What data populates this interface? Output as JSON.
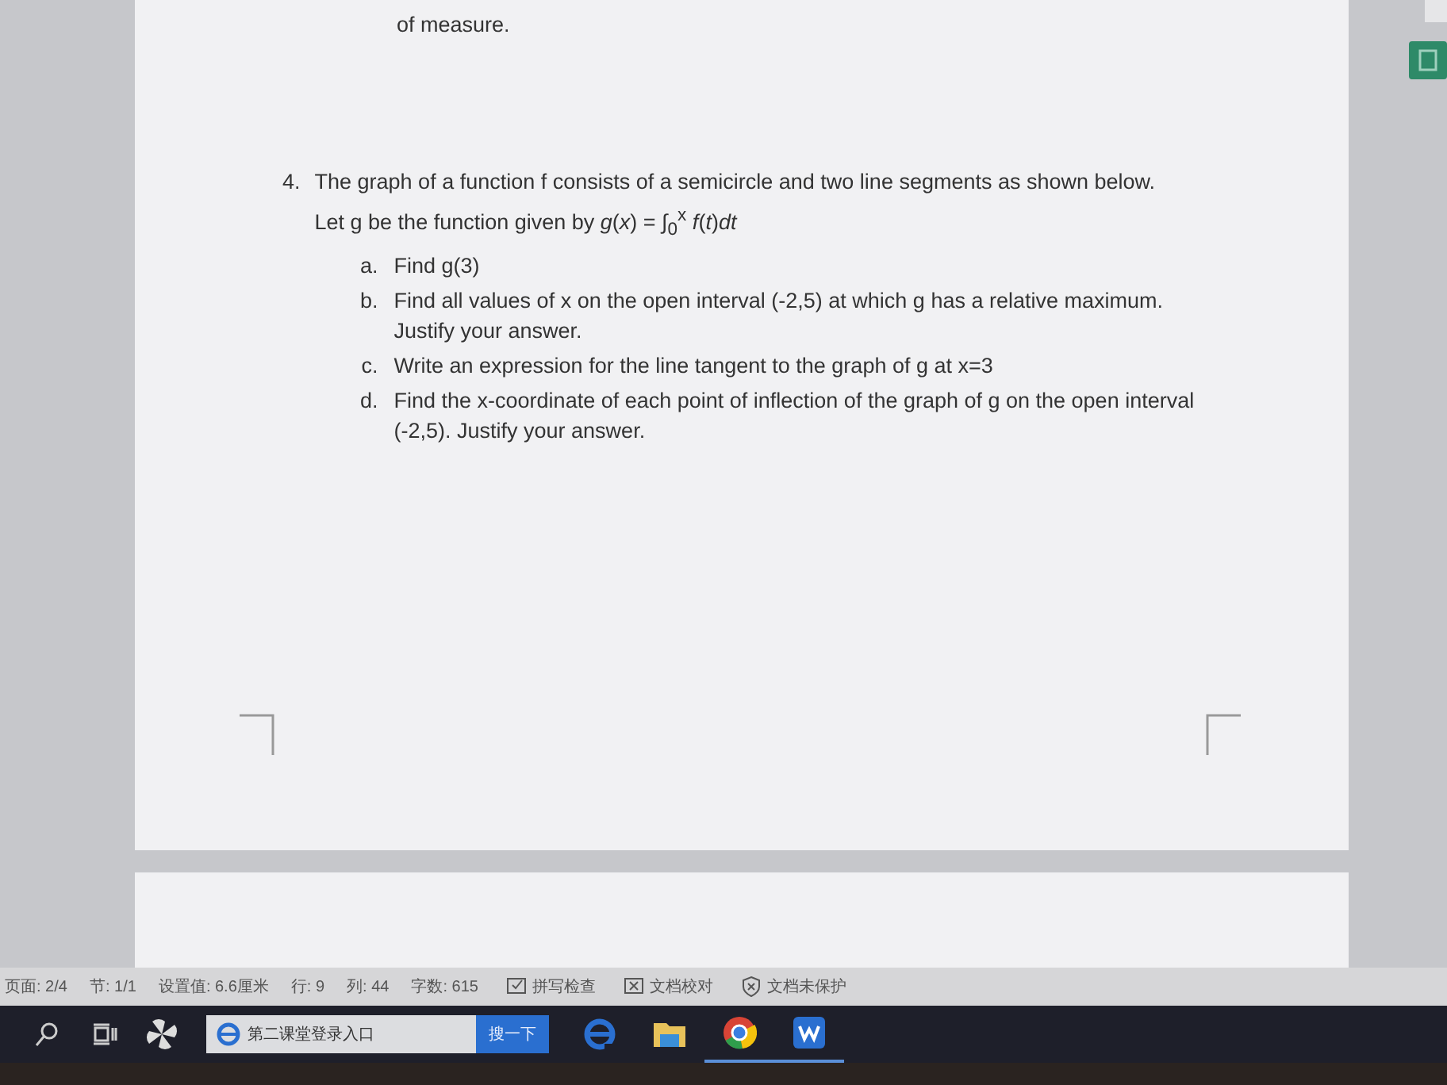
{
  "document": {
    "top_text": "of measure.",
    "question": {
      "number": "4.",
      "lines": [
        "The graph of a function f consists of a semicircle and two line segments as shown below.",
        "Let g be the function given by *g*(*x*) = ∫$_{0}$$^{x}$ *f*(*t*)*dt*"
      ],
      "parts": [
        {
          "label": "a.",
          "text": "Find g(3)"
        },
        {
          "label": "b.",
          "text": "Find all values of x on the open interval (-2,5) at which g has a relative maximum. Justify your answer."
        },
        {
          "label": "c.",
          "text": "Write an expression for the line tangent to the graph of g at x=3"
        },
        {
          "label": "d.",
          "text": "Find the x-coordinate of each point of inflection of the graph of g on the open interval (-2,5). Justify your answer."
        }
      ]
    }
  },
  "status_bar": {
    "items": [
      {
        "kind": "text",
        "text": "页面: 2/4"
      },
      {
        "kind": "text",
        "text": "节: 1/1"
      },
      {
        "kind": "text",
        "text": "设置值: 6.6厘米"
      },
      {
        "kind": "text",
        "text": "行: 9"
      },
      {
        "kind": "text",
        "text": "列: 44"
      },
      {
        "kind": "text",
        "text": "字数: 615"
      },
      {
        "kind": "check",
        "text": "拼写检查"
      },
      {
        "kind": "xbox",
        "text": "文档校对"
      },
      {
        "kind": "shield",
        "text": "文档未保护"
      }
    ]
  },
  "taskbar": {
    "search": {
      "value": "第二课堂登录入口",
      "button": "搜一下"
    },
    "apps": [
      {
        "kind": "edge",
        "running": false
      },
      {
        "kind": "folder",
        "running": false
      },
      {
        "kind": "chrome",
        "running": true
      },
      {
        "kind": "wps",
        "running": true
      }
    ]
  }
}
